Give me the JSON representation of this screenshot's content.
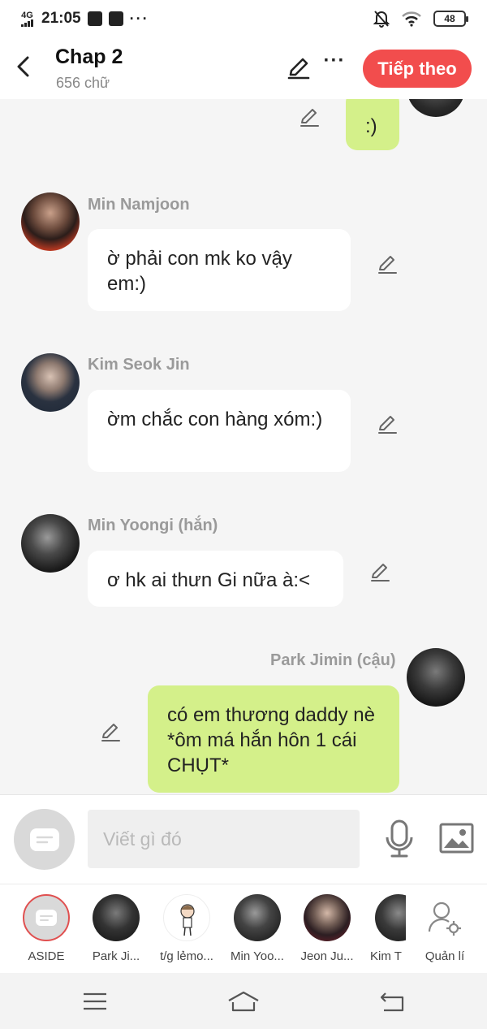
{
  "status_bar": {
    "network": "4G",
    "time": "21:05",
    "battery": "48",
    "notif_icons": [
      "mail-icon",
      "facebook-icon",
      "messenger-icon"
    ]
  },
  "header": {
    "title": "Chap 2",
    "subtitle": "656 chữ",
    "next_label": "Tiếp theo",
    "accent": "#f24d4d"
  },
  "messages": [
    {
      "side": "right",
      "sender": "",
      "text": ":)"
    },
    {
      "side": "left",
      "sender": "Min Namjoon",
      "text": "ờ phải con mk ko vậy em:)"
    },
    {
      "side": "left",
      "sender": "Kim Seok Jin",
      "text": "ờm chắc con hàng xóm:)"
    },
    {
      "side": "left",
      "sender": "Min Yoongi (hắn)",
      "text": "ơ hk ai thưn Gi nữa à:<"
    },
    {
      "side": "right",
      "sender": "Park Jimin (cậu)",
      "text": "có em thương daddy nè *ôm má hắn hôn 1 cái CHỤT*"
    }
  ],
  "input": {
    "placeholder": "Viết gì đó"
  },
  "characters": [
    {
      "label": "ASIDE"
    },
    {
      "label": "Park Ji..."
    },
    {
      "label": "t/g lẻmo..."
    },
    {
      "label": "Min Yoo..."
    },
    {
      "label": "Jeon Ju..."
    },
    {
      "label": "Kim T"
    },
    {
      "label": "Quản lí"
    }
  ],
  "colors": {
    "bubble_right": "#d4f08a",
    "bubble_left": "#ffffff",
    "background": "#f5f5f5"
  }
}
